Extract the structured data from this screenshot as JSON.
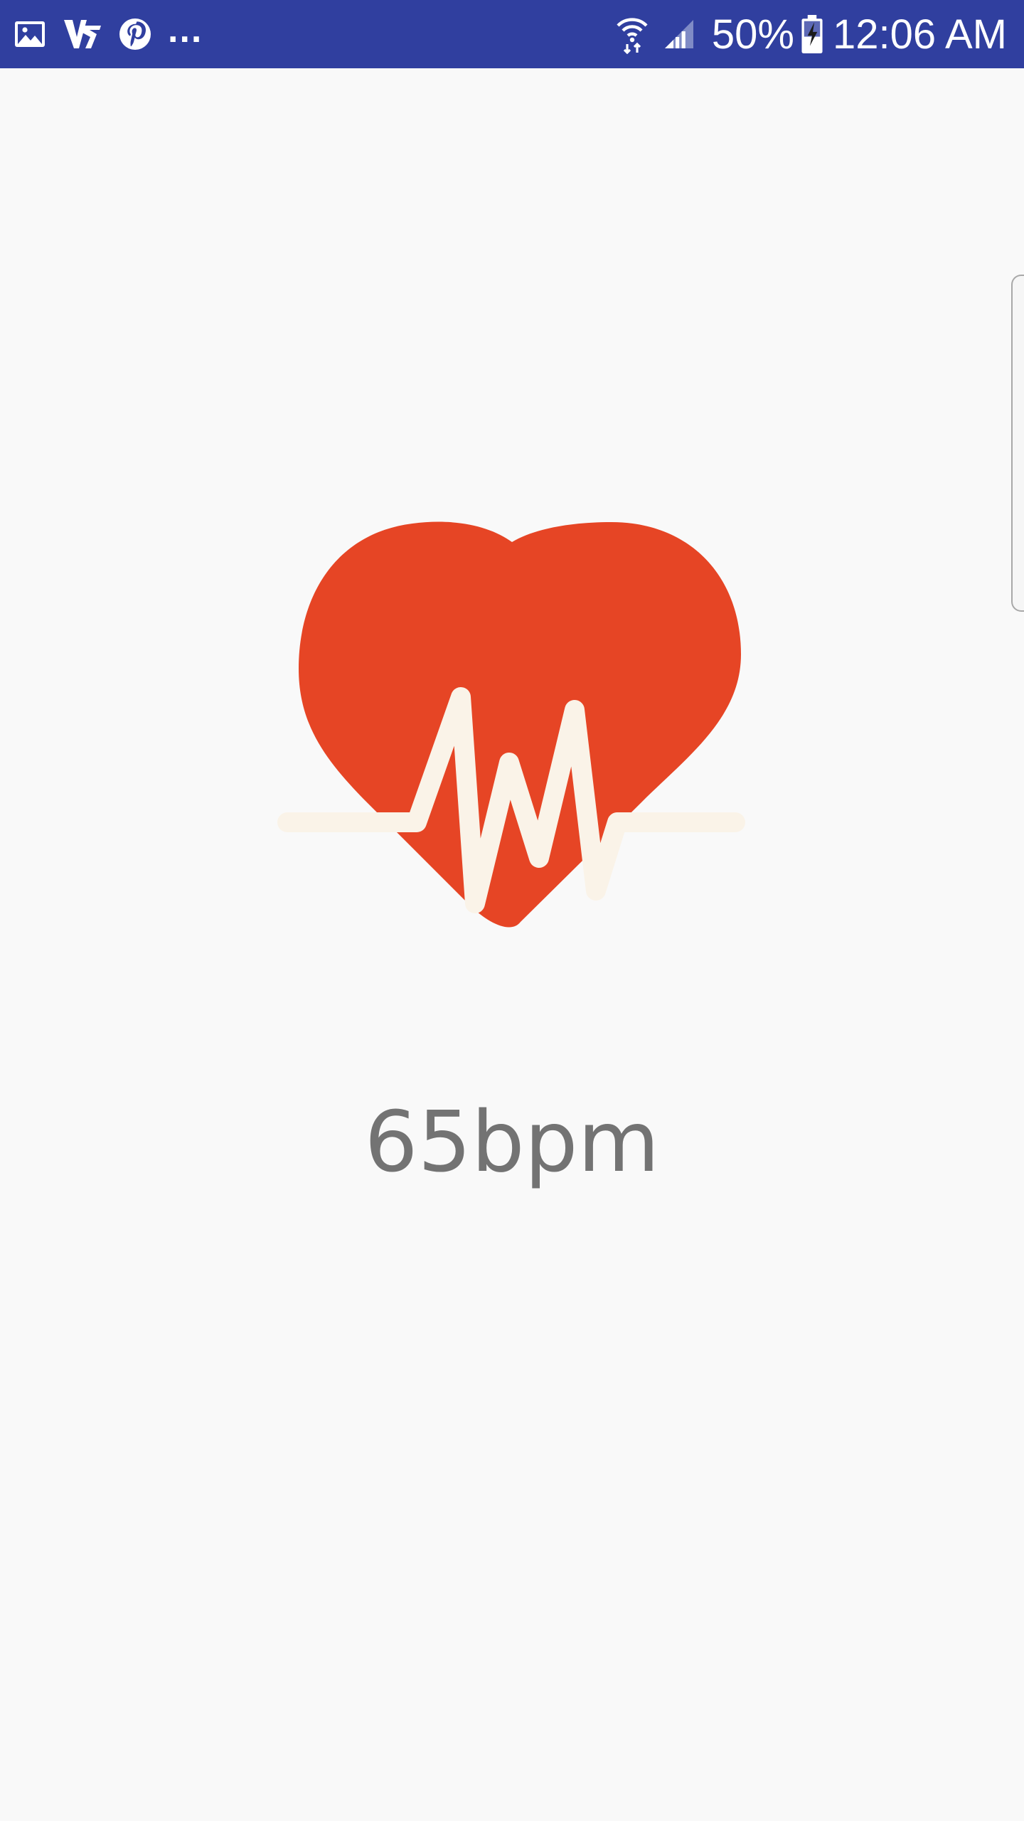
{
  "status_bar": {
    "background_color": "#303f9f",
    "left_icons": [
      "gallery-icon",
      "vpn-app-icon",
      "pinterest-icon"
    ],
    "more_indicator": "...",
    "right_icons": [
      "wifi-icon",
      "cellular-signal-icon",
      "battery-charging-icon"
    ],
    "battery_percent": "50%",
    "time": "12:06 AM"
  },
  "main": {
    "icon": "heart-rate-icon",
    "heart_color": "#e64525",
    "pulse_color": "#faf3e8",
    "bpm": "65bpm"
  }
}
